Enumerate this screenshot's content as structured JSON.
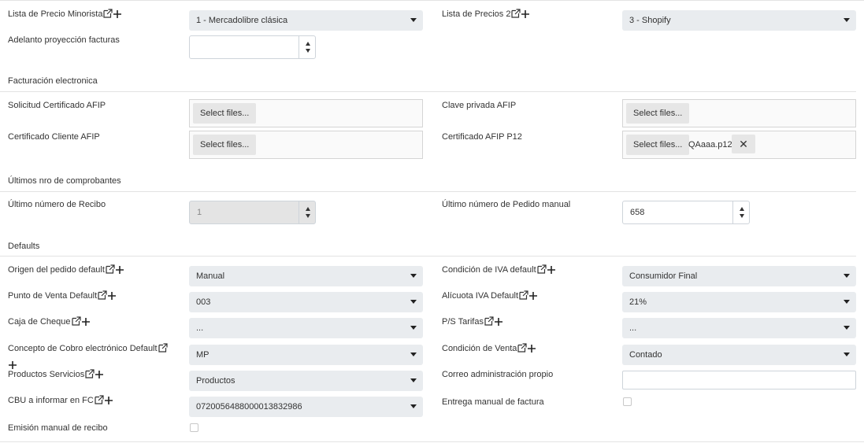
{
  "fields": {
    "lista_minorista": {
      "label": "Lista de Precio Minorista",
      "value": "1 - Mercadolibre clásica"
    },
    "lista_precios2": {
      "label": "Lista de Precios 2",
      "value": "3 - Shopify"
    },
    "adelanto": {
      "label": "Adelanto proyección facturas",
      "value": ""
    }
  },
  "sections": {
    "facturacion": "Facturación electronica",
    "ultimos": "Últimos nro de comprobantes",
    "defaults": "Defaults"
  },
  "uploads": {
    "select_label": "Select files...",
    "solicitud": {
      "label": "Solicitud Certificado AFIP"
    },
    "clave": {
      "label": "Clave privada AFIP"
    },
    "cert_cliente": {
      "label": "Certificado Cliente AFIP"
    },
    "cert_p12": {
      "label": "Certificado AFIP P12",
      "file": "QAaaa.p12",
      "remove": "✕"
    }
  },
  "numbers": {
    "recibo": {
      "label": "Último número de Recibo",
      "value": "1"
    },
    "pedido": {
      "label": "Último número de Pedido manual",
      "value": "658"
    }
  },
  "defaults": {
    "origen": {
      "label": "Origen del pedido default",
      "value": "Manual"
    },
    "cond_iva": {
      "label": "Condición de IVA default",
      "value": "Consumidor Final"
    },
    "punto_venta": {
      "label": "Punto de Venta Default",
      "value": "003"
    },
    "alicuota": {
      "label": "Alícuota IVA Default",
      "value": "21%"
    },
    "caja_cheque": {
      "label": "Caja de Cheque",
      "value": "..."
    },
    "ps_tarifas": {
      "label": "P/S Tarifas",
      "value": "..."
    },
    "concepto": {
      "label": "Concepto de Cobro electrónico Default",
      "value": "MP"
    },
    "cond_venta": {
      "label": "Condición de Venta",
      "value": "Contado"
    },
    "productos": {
      "label": "Productos Servicios",
      "value": "Productos"
    },
    "correo": {
      "label": "Correo administración propio",
      "value": ""
    },
    "cbu": {
      "label": "CBU a informar en FC",
      "value": "0720056488000013832986"
    },
    "entrega": {
      "label": "Entrega manual de factura"
    },
    "emision": {
      "label": "Emisión manual de recibo"
    }
  },
  "icons": {
    "external": "external-link-icon",
    "add": "plus-icon"
  },
  "colors": {
    "field_bg": "#e9ecef",
    "border": "#ced4da",
    "divider": "#e3e3e3"
  }
}
